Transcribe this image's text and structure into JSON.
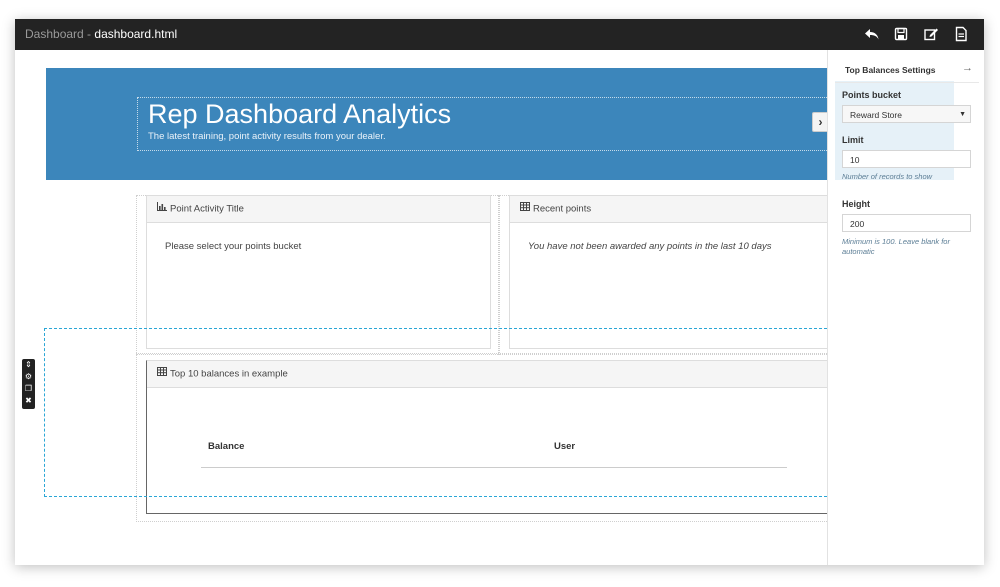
{
  "window": {
    "app_name": "Dashboard",
    "separator": " - ",
    "file_name": "dashboard.html"
  },
  "toolbar": {
    "icons": [
      "undo-icon",
      "save-icon",
      "edit-icon",
      "file-icon"
    ]
  },
  "hero": {
    "title": "Rep Dashboard Analytics",
    "subtitle": "The latest training, point activity results from your dealer.",
    "background_color": "#3c86bb",
    "collapse_glyph": "›"
  },
  "panels": {
    "point_activity": {
      "title": "Point Activity Title",
      "message": "Please select your points bucket"
    },
    "recent_points": {
      "title": "Recent points",
      "message": "You have not been awarded any points in the last 10 days"
    },
    "top_balances": {
      "title": "Top 10 balances in example",
      "columns": [
        "Balance",
        "User"
      ]
    }
  },
  "selection": {
    "accent_color": "#2aa6d6",
    "tools": [
      "move-icon",
      "settings-icon",
      "copy-icon",
      "close-icon"
    ]
  },
  "settings_panel": {
    "title": "Top Balances Settings",
    "fields": {
      "bucket": {
        "label": "Points bucket",
        "value": "Reward Store"
      },
      "limit": {
        "label": "Limit",
        "value": "10",
        "help": "Number of records to show"
      },
      "height": {
        "label": "Height",
        "value": "200",
        "help": "Minimum is 100. Leave blank for automatic"
      }
    }
  }
}
